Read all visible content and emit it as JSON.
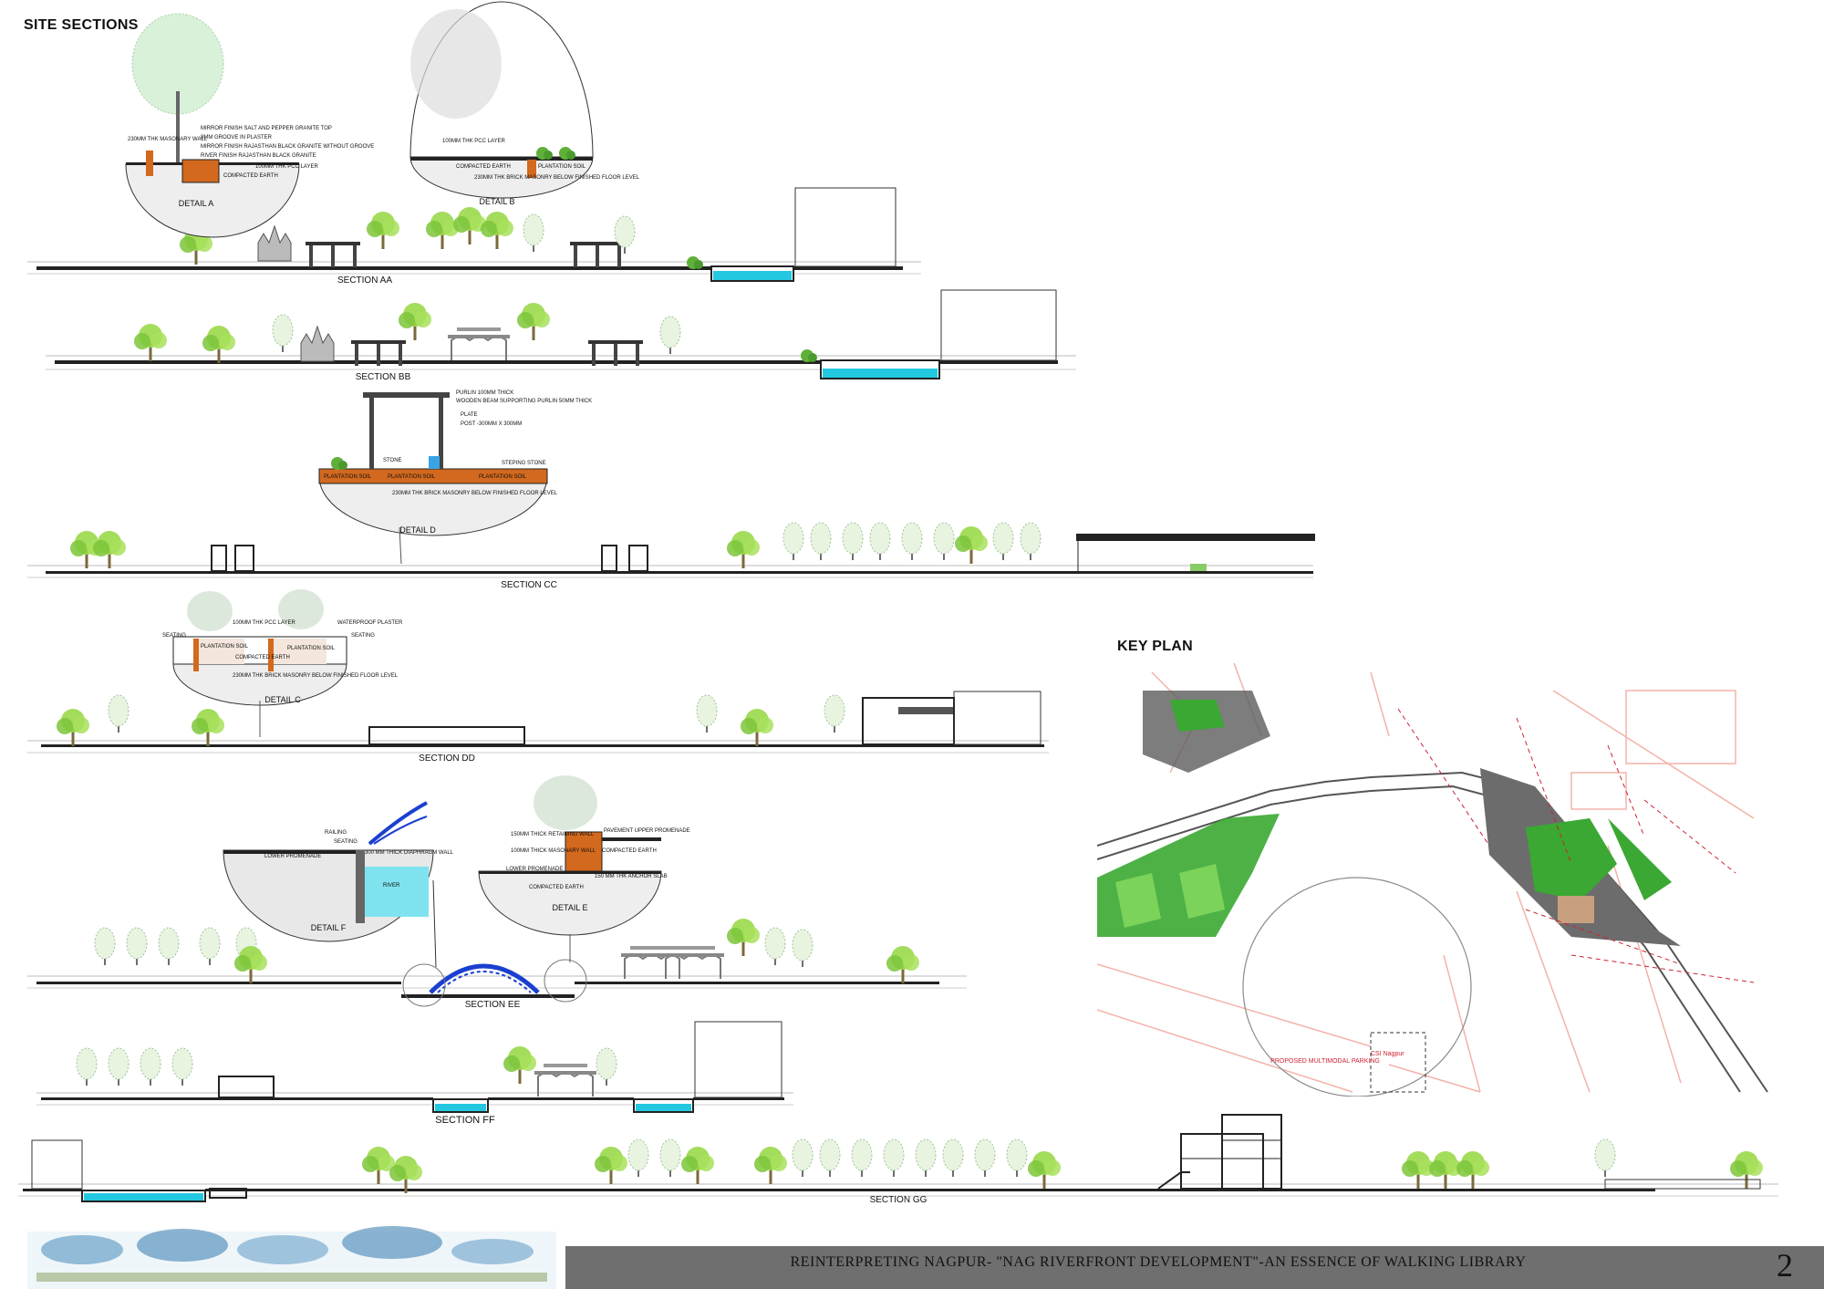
{
  "page": {
    "heading": "SITE SECTIONS",
    "key_plan_heading": "KEY PLAN",
    "footer_title": "REINTERPRETING NAGPUR- \"NAG RIVERFRONT DEVELOPMENT\"-AN ESSENCE OF WALKING LIBRARY",
    "page_number": "2"
  },
  "sections": {
    "aa": "SECTION AA",
    "bb": "SECTION BB",
    "cc": "SECTION CC",
    "dd": "SECTION DD",
    "ee": "SECTION EE",
    "ff": "SECTION FF",
    "gg": "SECTION GG"
  },
  "details": {
    "a": {
      "label": "DETAIL A",
      "notes": [
        "MIRROR FINISH SALT AND PEPPER GRANITE TOP",
        "8MM GROOVE IN PLASTER",
        "MIRROR FINISH RAJASTHAN BLACK GRANITE WITHOUT GROOVE",
        "RIVER FINISH RAJASTHAN BLACK GRANITE",
        "230MM THK MASONARY WALL",
        "COMPACTED EARTH",
        "100MM THK PCC LAYER"
      ]
    },
    "b": {
      "label": "DETAIL B",
      "notes": [
        "100MM THK PCC LAYER",
        "COMPACTED EARTH",
        "PLANTATION SOIL",
        "230MM THK BRICK MASONRY BELOW FINISHED FLOOR LEVEL"
      ]
    },
    "c": {
      "label": "DETAIL C",
      "notes": [
        "SEATING",
        "100MM THK PCC LAYER",
        "WATERPROOF PLASTER",
        "SEATING",
        "PLANTATION SOIL",
        "COMPACTED EARTH",
        "PLANTATION SOIL",
        "230MM THK BRICK MASONRY BELOW FINISHED FLOOR LEVEL"
      ]
    },
    "d": {
      "label": "DETAIL D",
      "notes": [
        "PURLIN 100MM THICK",
        "WOODEN BEAM SUPPORTING PURLIN 50MM THICK",
        "PLATE",
        "POST -300MM X 300MM",
        "STONE",
        "STEPING STONE",
        "PLANTATION SOIL",
        "PLANTATION SOIL",
        "PLANTATION SOIL",
        "230MM THK BRICK MASONRY BELOW FINISHED FLOOR LEVEL"
      ]
    },
    "e": {
      "label": "DETAIL E",
      "notes": [
        "150MM THICK RETAINING WALL",
        "100MM THICK MASONARY WALL",
        "LOWER PROMENADE",
        "PAVEMENT UPPER PROMENADE",
        "COMPACTED EARTH",
        "150 MM THK ANCHOR SLAB",
        "COMPACTED EARTH"
      ]
    },
    "f": {
      "label": "DETAIL F",
      "notes": [
        "RAILING",
        "SEATING",
        "LOWER PROMENADE",
        "300 MM THICK DIAPHRAGM WALL",
        "RIVER"
      ]
    }
  },
  "key_plan": {
    "labels": [
      "PROPOSED MULTIMODAL PARKING",
      "CSI Nagpur"
    ]
  },
  "colors": {
    "water": "#22c8e0",
    "tree": "#8fd43a",
    "soil": "#d2691e",
    "footer": "#6f6f6f",
    "plan_green": "#3aa832",
    "road_line": "#f2b3a8"
  }
}
